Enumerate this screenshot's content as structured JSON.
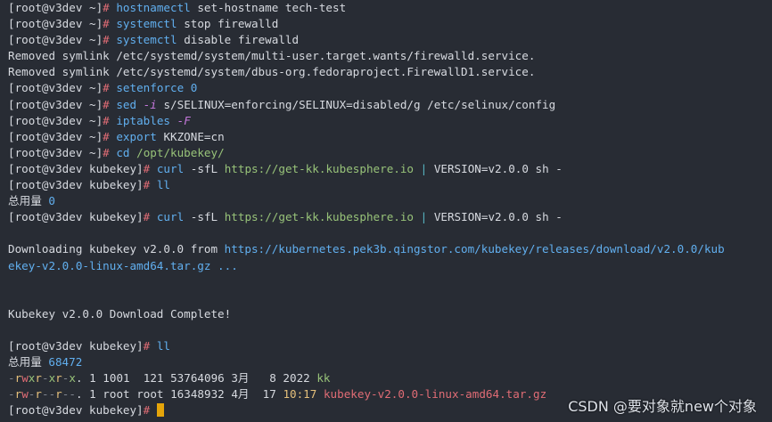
{
  "prompt_home": "[root@v3dev ~]",
  "prompt_kubekey": "[root@v3dev kubekey]",
  "hash": "#",
  "lines": {
    "l1": {
      "cmd": "hostnamectl",
      "args": "set-hostname tech-test"
    },
    "l2": {
      "cmd": "systemctl",
      "args": "stop firewalld"
    },
    "l3": {
      "cmd": "systemctl",
      "args": "disable firewalld"
    },
    "l4": "Removed symlink /etc/systemd/system/multi-user.target.wants/firewalld.service.",
    "l5": "Removed symlink /etc/systemd/system/dbus-org.fedoraproject.FirewallD1.service.",
    "l6": {
      "cmd": "setenforce",
      "num": "0"
    },
    "l7": {
      "cmd": "sed",
      "flag": "-i",
      "args": "s/SELINUX=enforcing/SELINUX=disabled/g /etc/selinux/config"
    },
    "l8": {
      "cmd": "iptables",
      "flag": "-F"
    },
    "l9": {
      "cmd": "export",
      "args": "KKZONE=cn"
    },
    "l10": {
      "cmd": "cd",
      "args": "/opt/kubekey/"
    },
    "l11": {
      "cmd": "curl",
      "flag": "-sfL",
      "url": "https://get-kk.kubesphere.io",
      "pipe": "|",
      "rest": "VERSION=v2.0.0 sh -"
    },
    "l12": {
      "cmd": "ll"
    },
    "l13": {
      "label": "总用量",
      "num": "0"
    },
    "l14": {
      "cmd": "curl",
      "flag": "-sfL",
      "url": "https://get-kk.kubesphere.io",
      "pipe": "|",
      "rest": "VERSION=v2.0.0 sh -"
    },
    "l16": {
      "text": "Downloading kubekey v2.0.0 from ",
      "url": "https://kubernetes.pek3b.qingstor.com/kubekey/releases/download/v2.0.0/kub"
    },
    "l17": "ekey-v2.0.0-linux-amd64.tar.gz ...",
    "l20": "Kubekey v2.0.0 Download Complete!",
    "l22": {
      "cmd": "ll"
    },
    "l23": {
      "label": "总用量",
      "num": "68472"
    },
    "l24": {
      "perms": "-rwxr-xr-x.",
      "meta": " 1 1001  121 53764096 3月   8 2022 ",
      "name": "kk"
    },
    "l25": {
      "perms": "-rw-r--r--.",
      "meta": " 1 root root 16348932 4月  17 ",
      "time": "10:17",
      "name": "kubekey-v2.0.0-linux-amd64.tar.gz"
    }
  },
  "watermark": "CSDN @要对象就new个对象"
}
